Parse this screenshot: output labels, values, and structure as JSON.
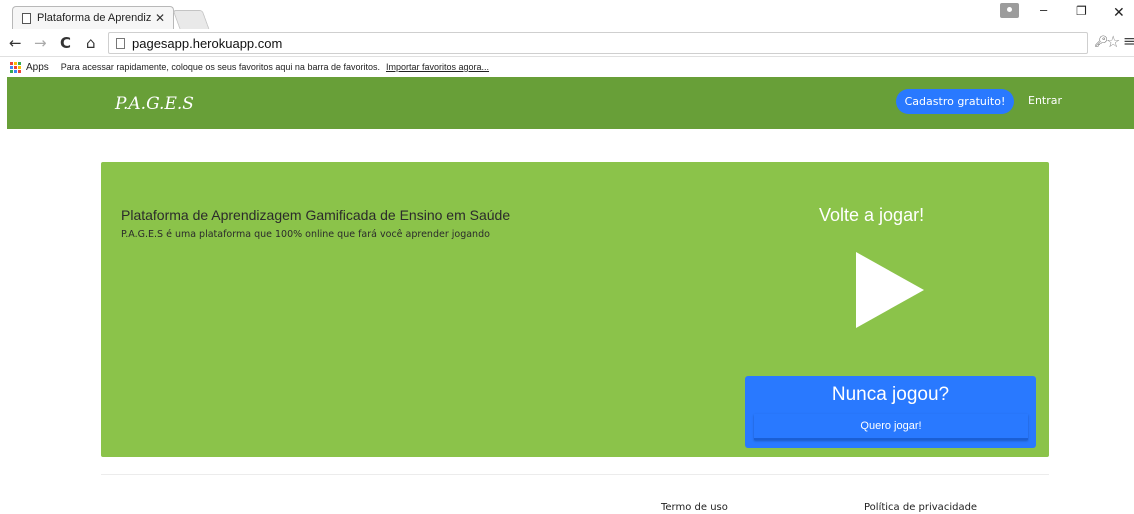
{
  "browser": {
    "tab_title": "Plataforma de Aprendizag",
    "tab_close": "✕",
    "url": "pagesapp.herokuapp.com",
    "bookmarks_apps": "Apps",
    "bookmarks_hint": "Para acessar rapidamente, coloque os seus favoritos aqui na barra de favoritos.",
    "bookmarks_import": "Importar favoritos agora..."
  },
  "site": {
    "brand": "P.A.G.E.S",
    "signup_label": "Cadastro gratuito!",
    "login_label": "Entrar"
  },
  "hero": {
    "title": "Plataforma de Aprendizagem Gamificada de Ensino em Saúde",
    "subtitle": "P.A.G.E.S é uma plataforma que 100% online que fará você aprender jogando",
    "replay_heading": "Volte a jogar!",
    "new_player_heading": "Nunca jogou?",
    "new_player_button": "Quero jogar!"
  },
  "footer": {
    "terms": "Termo de uso",
    "privacy": "Política de privacidade"
  },
  "colors": {
    "navbar": "#689f38",
    "hero": "#8bc34a",
    "accent": "#2979ff"
  }
}
